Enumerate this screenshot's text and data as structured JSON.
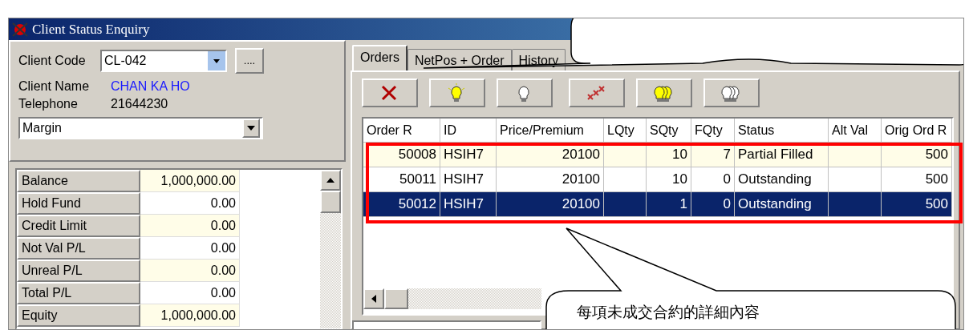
{
  "window": {
    "title": "Client Status Enquiry"
  },
  "client": {
    "code_label": "Client Code",
    "code_value": "CL-042",
    "lookup_button": "....",
    "name_label": "Client Name",
    "name_value": "CHAN KA HO",
    "phone_label": "Telephone",
    "phone_value": "21644230",
    "account_type": "Margin"
  },
  "balances": [
    {
      "label": "Balance",
      "value": "1,000,000.00"
    },
    {
      "label": "Hold Fund",
      "value": "0.00"
    },
    {
      "label": "Credit Limit",
      "value": "0.00"
    },
    {
      "label": "Not Val P/L",
      "value": "0.00"
    },
    {
      "label": "Unreal P/L",
      "value": "0.00"
    },
    {
      "label": "Total P/L",
      "value": "0.00"
    },
    {
      "label": "Equity",
      "value": "1,000,000.00"
    }
  ],
  "tabs": [
    {
      "label": "Orders",
      "selected": true
    },
    {
      "label": "NetPos + Order",
      "selected": false
    },
    {
      "label": "History",
      "selected": false
    }
  ],
  "toolbar": [
    {
      "kind": "cancel"
    },
    {
      "kind": "bulb-on"
    },
    {
      "kind": "bulb-off"
    },
    {
      "kind": "cancel-all"
    },
    {
      "kind": "bulbs-on"
    },
    {
      "kind": "bulbs-off"
    }
  ],
  "table": {
    "columns": [
      "Order R",
      "ID",
      "Price/Premium",
      "LQty",
      "SQty",
      "FQty",
      "Status",
      "Alt Val",
      "Orig Ord R"
    ],
    "rows": [
      {
        "cells": [
          "50008",
          "HSIH7",
          "20100",
          "",
          "10",
          "7",
          "Partial Filled",
          "",
          "500"
        ],
        "selected": false
      },
      {
        "cells": [
          "50011",
          "HSIH7",
          "20100",
          "",
          "10",
          "0",
          "Outstanding",
          "",
          "500"
        ],
        "selected": false
      },
      {
        "cells": [
          "50012",
          "HSIH7",
          "20100",
          "",
          "1",
          "0",
          "Outstanding",
          "",
          "500"
        ],
        "selected": true
      }
    ]
  },
  "annotation": {
    "text": "每項未成交合約的詳細內容"
  }
}
